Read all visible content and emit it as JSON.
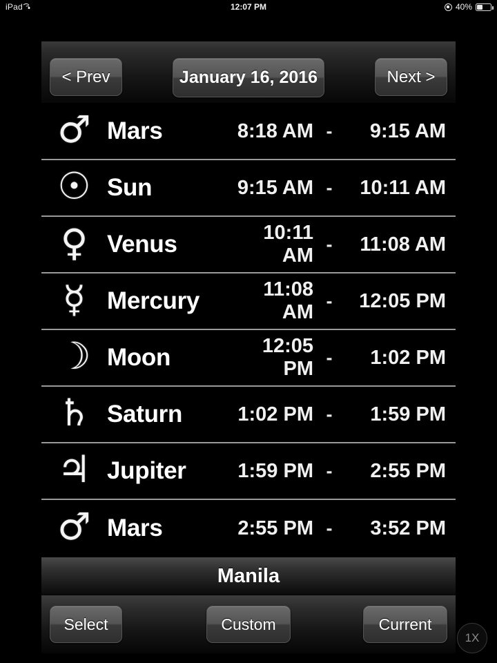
{
  "status_bar": {
    "device": "iPad",
    "wifi_icon": "wifi-icon",
    "time": "12:07 PM",
    "rotation_lock_icon": "rotation-lock-icon",
    "battery_percent": "40%",
    "battery_level": 40,
    "battery_icon": "battery-icon"
  },
  "navbar": {
    "prev_label": "< Prev",
    "date_label": "January 16, 2016",
    "next_label": "Next >"
  },
  "hours": {
    "rows": [
      {
        "glyph": "♂",
        "icon_name": "mars-glyph-icon",
        "planet": "Mars",
        "start": "8:18 AM",
        "dash": "-",
        "end": "9:15 AM"
      },
      {
        "glyph": "☉",
        "icon_name": "sun-glyph-icon",
        "planet": "Sun",
        "start": "9:15 AM",
        "dash": "-",
        "end": "10:11 AM"
      },
      {
        "glyph": "♀",
        "icon_name": "venus-glyph-icon",
        "planet": "Venus",
        "start": "10:11 AM",
        "dash": "-",
        "end": "11:08 AM"
      },
      {
        "glyph": "☿",
        "icon_name": "mercury-glyph-icon",
        "planet": "Mercury",
        "start": "11:08 AM",
        "dash": "-",
        "end": "12:05 PM"
      },
      {
        "glyph": "☽",
        "icon_name": "moon-glyph-icon",
        "planet": "Moon",
        "start": "12:05 PM",
        "dash": "-",
        "end": "1:02 PM"
      },
      {
        "glyph": "♄",
        "icon_name": "saturn-glyph-icon",
        "planet": "Saturn",
        "start": "1:02 PM",
        "dash": "-",
        "end": "1:59 PM"
      },
      {
        "glyph": "♃",
        "icon_name": "jupiter-glyph-icon",
        "planet": "Jupiter",
        "start": "1:59 PM",
        "dash": "-",
        "end": "2:55 PM"
      },
      {
        "glyph": "♂",
        "icon_name": "mars-glyph-icon",
        "planet": "Mars",
        "start": "2:55 PM",
        "dash": "-",
        "end": "3:52 PM"
      }
    ]
  },
  "location": {
    "name": "Manila"
  },
  "toolbar": {
    "select_label": "Select",
    "custom_label": "Custom",
    "current_label": "Current"
  },
  "scale_badge": {
    "label": "1X"
  },
  "colors": {
    "background": "#000000",
    "text": "#ffffff",
    "separator": "#9a9a9a",
    "chrome_top": "#3a3a3a",
    "button_face": "#545454"
  }
}
